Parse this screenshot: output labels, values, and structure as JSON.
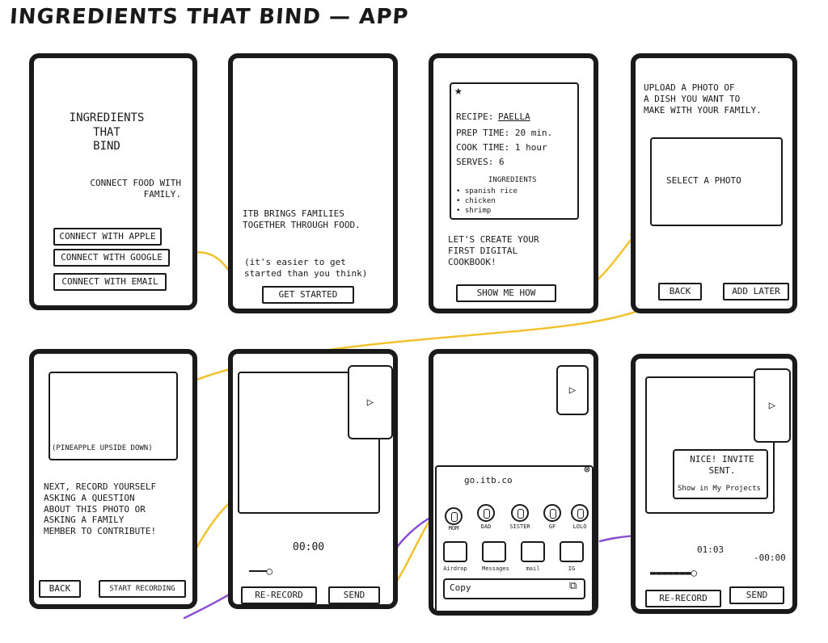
{
  "title": "INGREDIENTS THAT BIND — APP",
  "colors": {
    "ink": "#1a1a1a",
    "arrow_yellow": "#f2c12e",
    "arrow_purple": "#8a4fd1"
  },
  "screen1": {
    "app_name": "INGREDIENTS\nTHAT\nBIND",
    "tagline": "CONNECT FOOD WITH\nFAMILY.",
    "buttons": [
      "CONNECT WITH APPLE",
      "CONNECT WITH GOOGLE",
      "CONNECT WITH EMAIL"
    ]
  },
  "screen2": {
    "headline": "ITB BRINGS FAMILIES\nTOGETHER THROUGH FOOD.",
    "note": "(it's easier to get\nstarted than you think)",
    "cta": "GET STARTED"
  },
  "screen3": {
    "recipe_label": "RECIPE:",
    "recipe_name": "PAELLA",
    "prep": "PREP TIME: 20 min.",
    "cook": "COOK TIME: 1 hour",
    "serves": "SERVES: 6",
    "ingredients_title": "INGREDIENTS",
    "ingredients": [
      "• spanish rice",
      "• chicken",
      "• shrimp"
    ],
    "message": "LET'S CREATE YOUR\nFIRST DIGITAL\nCOOKBOOK!",
    "cta": "SHOW ME HOW"
  },
  "screen4": {
    "instructions": "UPLOAD A PHOTO OF\nA DISH YOU WANT TO\nMAKE WITH YOUR FAMILY.",
    "select_label": "SELECT A PHOTO",
    "back": "BACK",
    "add_later": "ADD LATER"
  },
  "screen5": {
    "caption": "(PINEAPPLE UPSIDE DOWN)",
    "instructions": "NEXT, RECORD YOURSELF\nASKING A QUESTION\nABOUT THIS PHOTO OR\nASKING A FAMILY\nMEMBER TO CONTRIBUTE!",
    "back": "BACK",
    "start": "START RECORDING"
  },
  "screen6": {
    "timer": "00:00",
    "rerecord": "RE-RECORD",
    "send": "SEND"
  },
  "screen7": {
    "link": "go.itb.co",
    "contacts": [
      "MOM",
      "DAD",
      "SISTER",
      "GF",
      "LOLO"
    ],
    "share_apps": [
      "Airdrop",
      "Messages",
      "mail",
      "IG"
    ],
    "copy": "Copy"
  },
  "screen8": {
    "toast": "NICE! INVITE\nSENT.",
    "toast_link": "Show in My Projects",
    "elapsed": "01:03",
    "remaining": "-00:00",
    "rerecord": "RE-RECORD",
    "send": "SEND"
  }
}
